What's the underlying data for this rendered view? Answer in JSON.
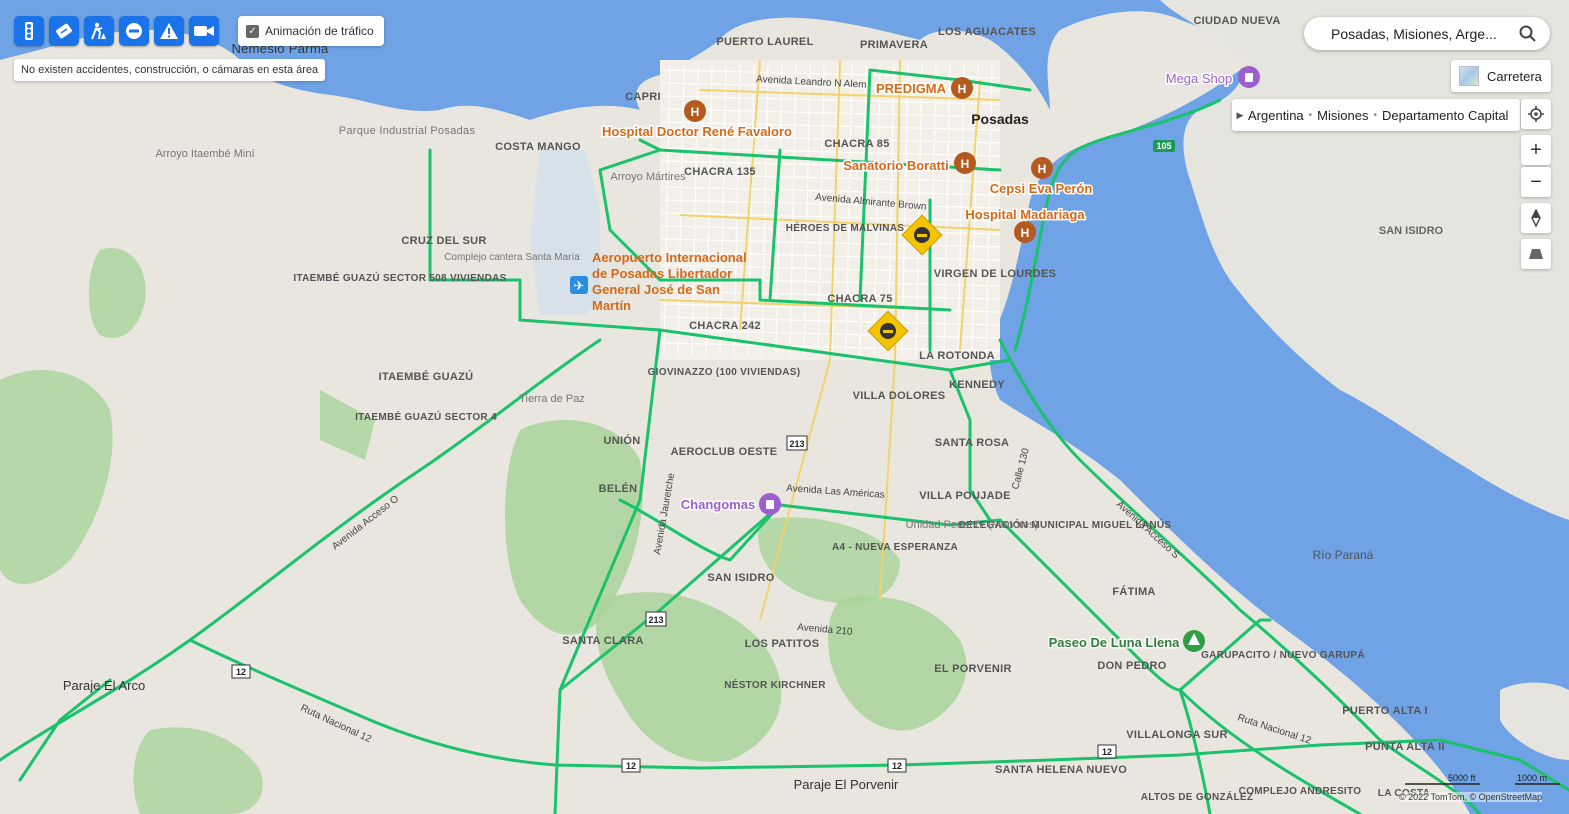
{
  "toolbar": {
    "buttons": [
      {
        "name": "traffic-flow-button",
        "icon": "traffic-light-icon"
      },
      {
        "name": "traffic-incidents-button",
        "icon": "incident-ticket-icon"
      },
      {
        "name": "construction-button",
        "icon": "roadwork-icon"
      },
      {
        "name": "road-closure-button",
        "icon": "no-entry-icon"
      },
      {
        "name": "warning-button",
        "icon": "warning-triangle-icon"
      },
      {
        "name": "cameras-button",
        "icon": "video-camera-icon"
      }
    ]
  },
  "traffic_animation": {
    "label": "Animación de tráfico",
    "checked": true
  },
  "notice": "No existen accidentes, construcción, o cámaras en esta área",
  "search": {
    "value": "Posadas, Misiones, Arge..."
  },
  "map_style": {
    "label": "Carretera"
  },
  "breadcrumb": [
    "Argentina",
    "Misiones",
    "Departamento Capital"
  ],
  "colors": {
    "water": "#6fa3e6",
    "land": "#e9e6df",
    "park": "#a9d39a",
    "traffic_free": "#19c26b",
    "button": "#1a73e8",
    "poi_label": "#d4691a",
    "shop": "#9b5fd0"
  },
  "map": {
    "city_label": "Posadas",
    "neighborhoods": [
      "Nemesio Parma",
      "PUERTO LAUREL",
      "PRIMAVERA",
      "LOS AGUACATES",
      "CIUDAD NUEVA",
      "CAPRI",
      "COSTA MANGO",
      "Parque Industrial Posadas",
      "CHACRA 85",
      "CHACRA 135",
      "CRUZ DEL SUR",
      "ITAEMBÉ GUAZÚ SECTOR 508 VIVIENDAS",
      "HÉROES DE MALVINAS",
      "VIRGEN DE LOURDES",
      "CHACRA 75",
      "CHACRA 242",
      "LA ROTONDA",
      "KENNEDY",
      "ITAEMBÉ GUAZÚ",
      "ITAEMBÉ GUAZÚ SECTOR 4",
      "GIOVINAZZO (100 VIVIENDAS)",
      "VILLA DOLORES",
      "UNIÓN",
      "AEROCLUB OESTE",
      "SANTA ROSA",
      "BELÉN",
      "VILLA POUJADE",
      "DELEGACIÓN MUNICIPAL MIGUEL LANÚS",
      "A4 - NUEVA ESPERANZA",
      "SAN ISIDRO",
      "SANTA CLARA",
      "LOS PATITOS",
      "FÁTIMA",
      "DON PEDRO",
      "GARUPACITO / NUEVO GARUPÁ",
      "NÉSTOR KIRCHNER",
      "EL PORVENIR",
      "PUERTO ALTA I",
      "PUNTA ALTA II",
      "VILLALONGA SUR",
      "SANTA HELENA NUEVO",
      "COMPLEJO ANDRESITO",
      "ALTOS DE GONZÁLEZ",
      "LA COSTA"
    ],
    "places": [
      "Parque Industrial Posadas",
      "Arroyo Itaembé Miní",
      "Arroyo Mártires",
      "Complejo cantera Santa María",
      "Tierra de Paz",
      "Unidad Penal IV (Menores)",
      "Paraje El Arco",
      "Paraje El Porvenir",
      "Río Paraná"
    ],
    "streets": [
      "Avenida Leandro N Alem",
      "Avenida Almirante Brown",
      "Avenida Las Américas",
      "Avenida 210",
      "Avenida Acceso O",
      "Avenida Acceso S",
      "Ruta Nacional 12",
      "Ruta Nacional 12",
      "Calle 130",
      "Avenida Jauretche"
    ],
    "pois": [
      {
        "name": "Hospital Doctor René Favaloro",
        "icon": "hospital-icon"
      },
      {
        "name": "PREDIGMA",
        "icon": "hospital-icon"
      },
      {
        "name": "Sanatorio Boratti",
        "icon": "hospital-icon"
      },
      {
        "name": "Cepsi Eva Perón",
        "icon": "hospital-icon"
      },
      {
        "name": "Hospital Madariaga",
        "icon": "hospital-icon"
      },
      {
        "name": "Aeropuerto Internacional de Posadas Libertador General José de San Martín",
        "icon": "airport-icon"
      },
      {
        "name": "Changomas",
        "icon": "shopping-bag-icon"
      },
      {
        "name": "Mega Shop",
        "icon": "shopping-bag-icon"
      },
      {
        "name": "Paseo De Luna Llena",
        "icon": "park-tree-icon"
      }
    ],
    "shields": [
      "105",
      "213",
      "213",
      "12",
      "12",
      "12",
      "12"
    ],
    "incidents": [
      "road-closure-marker",
      "road-closure-marker"
    ],
    "far_labels": [
      "SAN ISIDRO",
      "FÁTIMA"
    ]
  },
  "scale": {
    "left": "5000 ft",
    "right": "1000 m"
  },
  "copyright": "© 2022 TomTom, © OpenStreetMap"
}
